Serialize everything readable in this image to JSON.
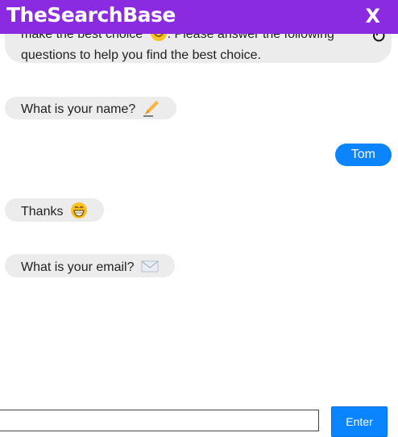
{
  "header": {
    "title": "TheSearchBase",
    "close_label": "X"
  },
  "chat": {
    "intro_line1": "make the best choice",
    "intro_line1b": ". Please answer the following",
    "intro_line2": "questions to help you find the best choice.",
    "refresh_symbol": "↻",
    "messages": [
      {
        "sender": "bot",
        "text": "What is your name?",
        "icon": "writing-hand-icon"
      },
      {
        "sender": "user",
        "text": "Tom"
      },
      {
        "sender": "bot",
        "text": "Thanks",
        "icon": "grinning-face-icon"
      },
      {
        "sender": "bot",
        "text": "What is your email?",
        "icon": "envelope-icon"
      }
    ]
  },
  "input": {
    "value": "",
    "placeholder": "",
    "button_label": "Enter"
  },
  "colors": {
    "header": "#8a2be2",
    "accent": "#0a84ff",
    "bubble": "#ececec"
  }
}
